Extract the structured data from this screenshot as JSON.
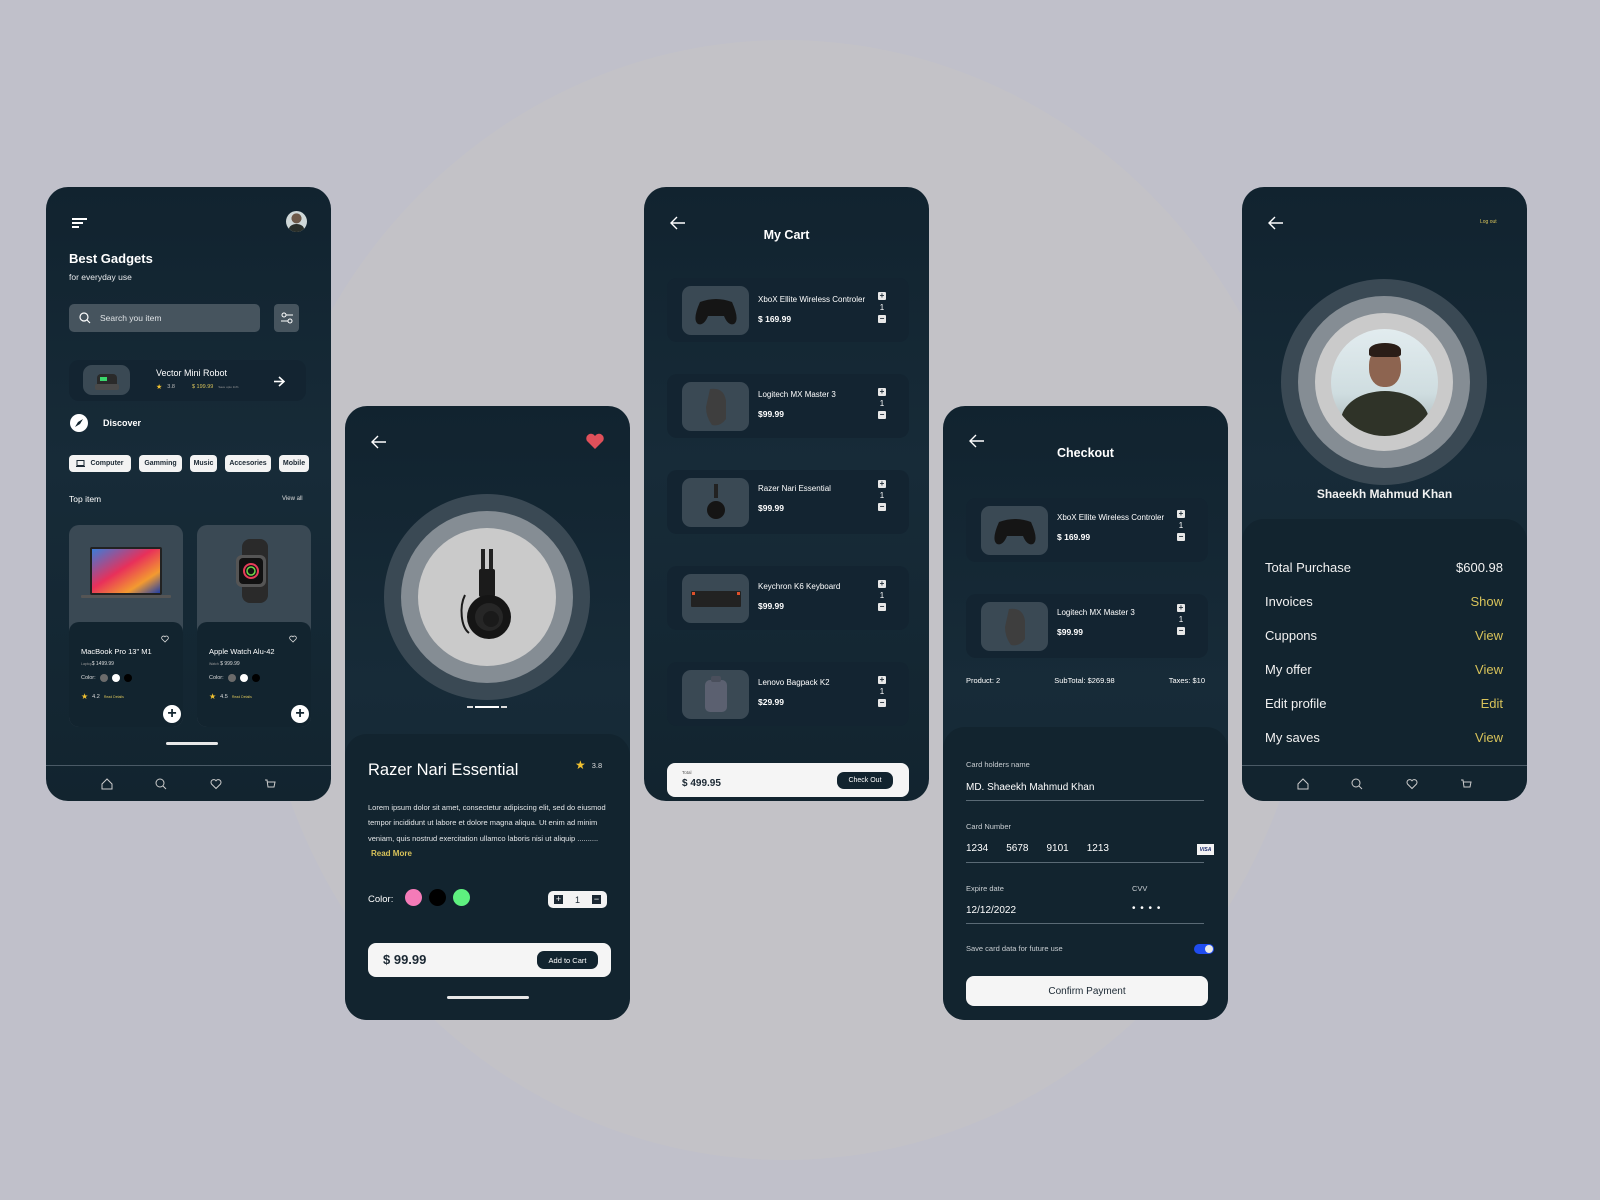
{
  "home": {
    "title": "Best Gadgets",
    "subtitle": "for everyday use",
    "search_placeholder": "Search you item",
    "featured": {
      "name": "Vector Mini Robot",
      "rating": "3.8",
      "price": "$ 199.99",
      "note": "Save upto 11%"
    },
    "discover_label": "Discover",
    "categories": [
      "Computer",
      "Gamming",
      "Music",
      "Accesories",
      "Mobile"
    ],
    "top_item_label": "Top item",
    "view_all": "View all",
    "products": [
      {
        "name": "MacBook Pro 13\" M1",
        "category": "Laptop",
        "price": "$ 1499.99",
        "color_label": "Color:",
        "rating": "4.2",
        "details": "Read Details",
        "colors": [
          "#6b6b6b",
          "#ffffff",
          "#000000"
        ]
      },
      {
        "name": "Apple Watch Alu-42",
        "category": "Watch",
        "price": "$ 999.99",
        "color_label": "Color:",
        "rating": "4.5",
        "details": "Read Details",
        "colors": [
          "#6b6b6b",
          "#ffffff",
          "#000000"
        ]
      }
    ]
  },
  "detail": {
    "name": "Razer Nari Essential",
    "rating": "3.8",
    "description": "Lorem ipsum dolor sit amet, consectetur adipiscing elit, sed do eiusmod tempor incididunt ut labore et dolore magna aliqua. Ut enim ad minim veniam, quis nostrud exercitation ullamco laboris nisi ut aliquip ..........",
    "read_more": "Read More",
    "color_label": "Color:",
    "colors": [
      "#f47bb8",
      "#000000",
      "#5ef07f"
    ],
    "quantity": "1",
    "price": "$ 99.99",
    "add_to_cart": "Add to Cart"
  },
  "cart": {
    "title": "My Cart",
    "items": [
      {
        "name": "XboX Ellite Wireless Controler",
        "price": "$ 169.99",
        "qty": "1"
      },
      {
        "name": "Logitech MX Master 3",
        "price": "$99.99",
        "qty": "1"
      },
      {
        "name": "Razer Nari Essential",
        "price": "$99.99",
        "qty": "1"
      },
      {
        "name": "Keychron K6 Keyboard",
        "price": "$99.99",
        "qty": "1"
      },
      {
        "name": "Lenovo Bagpack K2",
        "price": "$29.99",
        "qty": "1"
      }
    ],
    "total_label": "Total",
    "total": "$ 499.95",
    "checkout": "Check Out"
  },
  "checkout": {
    "title": "Checkout",
    "items": [
      {
        "name": "XboX Ellite Wireless Controler",
        "price": "$ 169.99",
        "qty": "1"
      },
      {
        "name": "Logitech MX Master 3",
        "price": "$99.99",
        "qty": "1"
      }
    ],
    "summary": {
      "product": "Product:  2",
      "subtotal": "SubTotal:  $269.98",
      "taxes": "Taxes:  $10"
    },
    "card_holder_label": "Card holders name",
    "card_holder": "MD. Shaeekh Mahmud Khan",
    "card_number_label": "Card Number",
    "card_number": [
      "1234",
      "5678",
      "9101",
      "1213"
    ],
    "card_brand": "VISA",
    "expire_label": "Expire date",
    "expire": "12/12/2022",
    "cvv_label": "CVV",
    "cvv": "• • • •",
    "save_label": "Save card data for future use",
    "save_enabled": true,
    "confirm": "Confirm Payment"
  },
  "profile": {
    "logout": "Log out",
    "name": "Shaeekh Mahmud Khan",
    "rows": [
      {
        "label": "Total Purchase",
        "value": "$600.98"
      },
      {
        "label": "Invoices",
        "value": "Show"
      },
      {
        "label": "Cuppons",
        "value": "View"
      },
      {
        "label": "My offer",
        "value": "View"
      },
      {
        "label": "Edit profile",
        "value": "Edit"
      },
      {
        "label": "My saves",
        "value": "View"
      }
    ]
  },
  "colors": {
    "accent": "#d7c25a",
    "background": "#c0c0ca",
    "panel": "#12242f",
    "heart": "#e0505a",
    "toggle": "#1f4cf0"
  }
}
